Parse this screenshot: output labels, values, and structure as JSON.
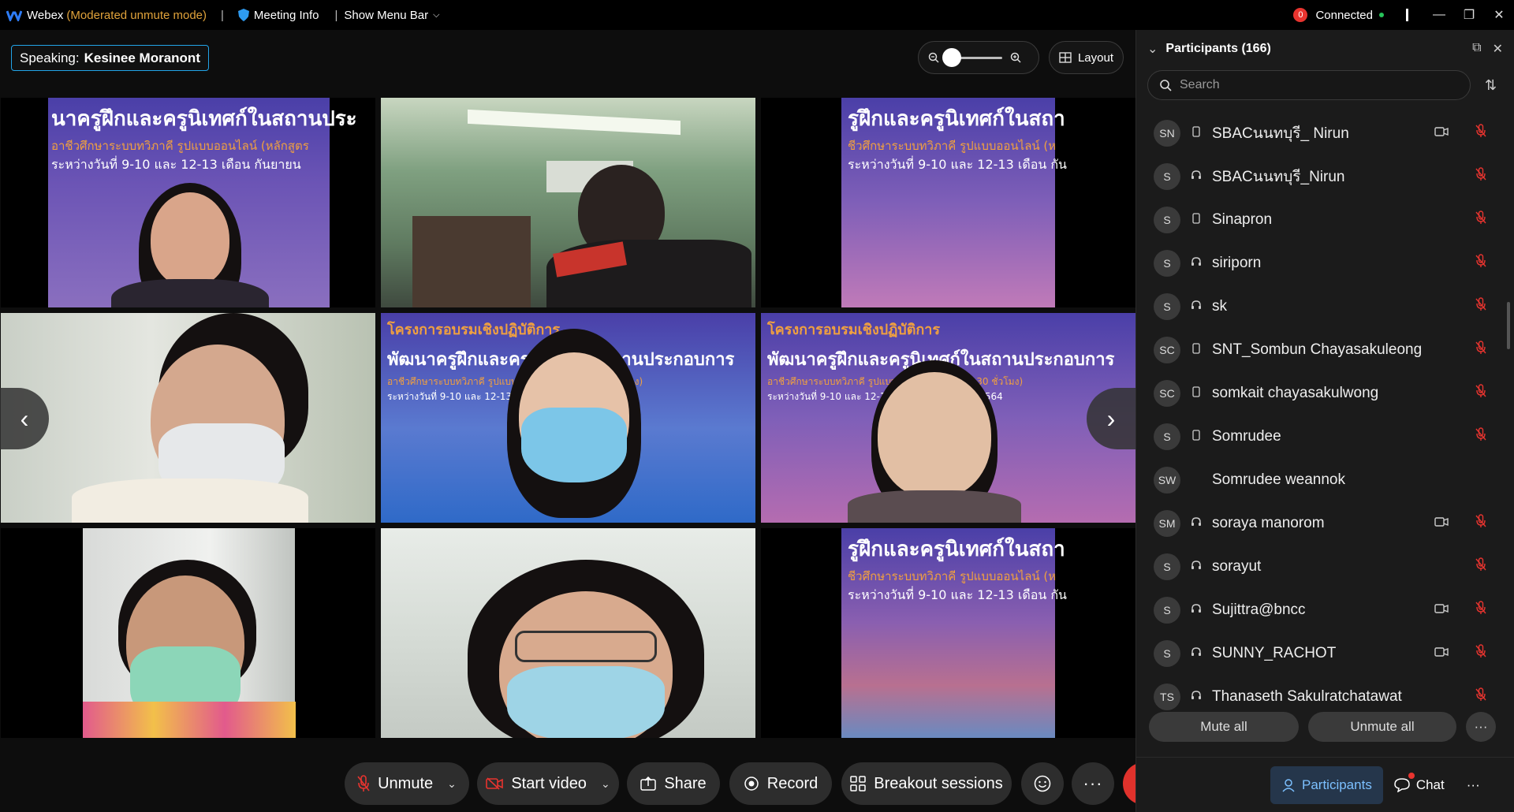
{
  "titlebar": {
    "app_name": "Webex",
    "mode": "(Moderated unmute mode)",
    "meeting_info": "Meeting Info",
    "show_menu_bar": "Show Menu Bar",
    "connection_count": "0",
    "connection_status": "Connected"
  },
  "speaking": {
    "label": "Speaking:",
    "name": "Kesinee Moranont"
  },
  "layout_label": "Layout",
  "banner_text": {
    "line1": "นาครูฝึกและครูนิเทศก์ในสถานประ",
    "line1b": "รูฝึกและครูนิเทศก์ในสถา",
    "line1c": "โครงการอบรมเชิงปฏิบัติการ",
    "line1d": "พัฒนาครูฝึกและครูนิเทศก์ในสถานประกอบการ",
    "line2": "อาชีวศึกษาระบบทวิภาคี รูปแบบออนไลน์ (หลักสูตร",
    "line2b": "ชีวศึกษาระบบทวิภาคี รูปแบบออนไลน์ (ห",
    "line2c": "อาชีวศึกษาระบบทวิภาคี รูปแบบออนไลน์ (หลักสูตร 30 ชั่วโมง)",
    "line3": "ระหว่างวันที่ 9-10 และ 12-13 เดือน กันยายน",
    "line3b": "ระหว่างวันที่ 9-10 และ 12-13 เดือน กัน",
    "line3c": "ระหว่างวันที่ 9-10 และ 12-13 เดือน กันยายน พ.ศ. 2564"
  },
  "controls": {
    "unmute": "Unmute",
    "start_video": "Start video",
    "share": "Share",
    "record": "Record",
    "breakout": "Breakout sessions"
  },
  "panel": {
    "title": "Participants (166)",
    "search_placeholder": "Search",
    "mute_all": "Mute all",
    "unmute_all": "Unmute all",
    "tab_participants": "Participants",
    "tab_chat": "Chat",
    "participants": [
      {
        "initials": "SN",
        "name": "SBACนนทบุรี_ Nirun",
        "device": "phone",
        "video": true,
        "muted": true
      },
      {
        "initials": "S",
        "name": "SBACนนทบุรี_Nirun",
        "device": "headset",
        "video": false,
        "muted": true
      },
      {
        "initials": "S",
        "name": "Sinapron",
        "device": "phone",
        "video": false,
        "muted": true
      },
      {
        "initials": "S",
        "name": "siriporn",
        "device": "headset",
        "video": false,
        "muted": true
      },
      {
        "initials": "S",
        "name": "sk",
        "device": "headset",
        "video": false,
        "muted": true
      },
      {
        "initials": "SC",
        "name": "SNT_Sombun Chayasakuleong",
        "device": "phone",
        "video": false,
        "muted": true
      },
      {
        "initials": "SC",
        "name": "somkait chayasakulwong",
        "device": "phone",
        "video": false,
        "muted": true
      },
      {
        "initials": "S",
        "name": "Somrudee",
        "device": "phone",
        "video": false,
        "muted": true
      },
      {
        "initials": "SW",
        "name": "Somrudee weannok",
        "device": "none",
        "video": false,
        "muted": false
      },
      {
        "initials": "SM",
        "name": "soraya manorom",
        "device": "headset",
        "video": true,
        "muted": true
      },
      {
        "initials": "S",
        "name": "sorayut",
        "device": "headset",
        "video": false,
        "muted": true
      },
      {
        "initials": "S",
        "name": "Sujittra@bncc",
        "device": "headset",
        "video": true,
        "muted": true
      },
      {
        "initials": "S",
        "name": "SUNNY_RACHOT",
        "device": "headset",
        "video": true,
        "muted": true
      },
      {
        "initials": "TS",
        "name": "Thanaseth Sakulratchatawat",
        "device": "headset",
        "video": false,
        "muted": true
      }
    ]
  },
  "colors": {
    "accent": "#22a4e8",
    "end_call": "#e0322c",
    "muted": "#e8342f",
    "mode": "#e0a23a"
  }
}
